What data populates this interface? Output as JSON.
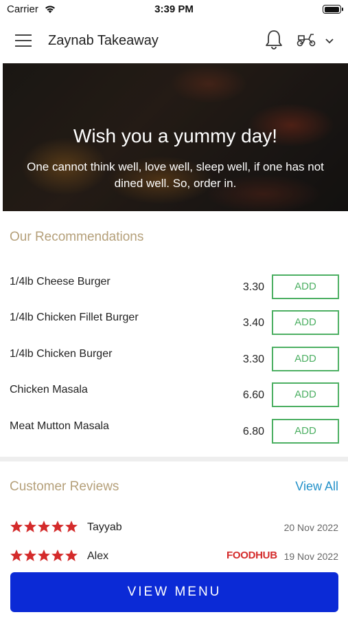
{
  "status_bar": {
    "carrier": "Carrier",
    "time": "3:39 PM",
    "battery_level": 1.0
  },
  "header": {
    "title": "Zaynab Takeaway",
    "icons": [
      "menu-icon",
      "bell-icon",
      "scooter-icon",
      "chevron-down-icon"
    ]
  },
  "hero": {
    "title": "Wish you a yummy day!",
    "text": "One cannot think well, love well, sleep well, if one has not dined well. So, order in."
  },
  "recommendations": {
    "title": "Our Recommendations",
    "add_label": "ADD",
    "items": [
      {
        "name": "1/4lb Cheese Burger",
        "price": "3.30"
      },
      {
        "name": "1/4lb Chicken Fillet Burger",
        "price": "3.40"
      },
      {
        "name": "1/4lb Chicken Burger",
        "price": "3.30"
      },
      {
        "name": "Chicken Masala",
        "price": "6.60"
      },
      {
        "name": "Meat Mutton Masala",
        "price": "6.80"
      }
    ]
  },
  "reviews": {
    "title": "Customer Reviews",
    "view_all": "View All",
    "items": [
      {
        "name": "Tayyab",
        "rating": 5,
        "date": "20 Nov 2022",
        "source": ""
      },
      {
        "name": "Alex",
        "rating": 5,
        "date": "19 Nov 2022",
        "source": "FOODHUB"
      }
    ]
  },
  "view_menu_label": "VIEW MENU",
  "colors": {
    "accent_green": "#4caf62",
    "section_title": "#b5a07a",
    "link_blue": "#2391c9",
    "button_blue": "#0b2ad6",
    "star_red": "#d42b2b"
  }
}
